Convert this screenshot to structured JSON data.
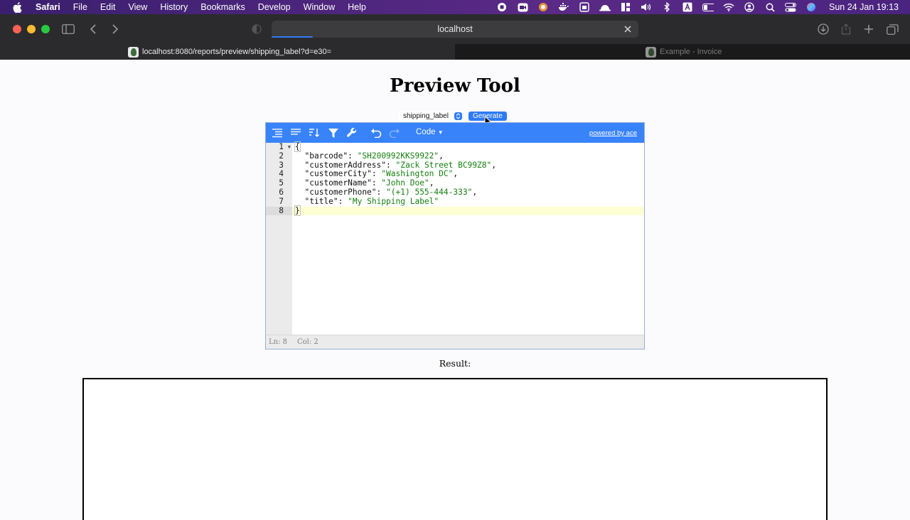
{
  "menubar": {
    "app_name": "Safari",
    "items": [
      "File",
      "Edit",
      "View",
      "History",
      "Bookmarks",
      "Develop",
      "Window",
      "Help"
    ],
    "clock": "Sun 24 Jan  19:13"
  },
  "browser": {
    "address": "localhost",
    "tabs": [
      {
        "title": "localhost:8080/reports/preview/shipping_label?d=e30="
      },
      {
        "title": "Example - Invoice"
      }
    ]
  },
  "page": {
    "title": "Preview Tool",
    "template_select": "shipping_label",
    "generate_label": "Generate",
    "result_label": "Result:"
  },
  "editor": {
    "mode_label": "Code",
    "powered_by": "powered by ace",
    "line_numbers": [
      "1",
      "2",
      "3",
      "4",
      "5",
      "6",
      "7",
      "8"
    ],
    "json_lines": [
      {
        "key": "barcode",
        "value": "SH200992KKS9922"
      },
      {
        "key": "customerAddress",
        "value": "Zack Street BC99Z8"
      },
      {
        "key": "customerCity",
        "value": "Washington DC"
      },
      {
        "key": "customerName",
        "value": "John Doe"
      },
      {
        "key": "customerPhone",
        "value": "(+1) 555-444-333"
      },
      {
        "key": "title",
        "value": "My Shipping Label"
      }
    ],
    "open_brace": "{",
    "close_brace": "}",
    "status": {
      "line": "Ln: 8",
      "col": "Col: 2"
    }
  },
  "colors": {
    "accent": "#3883fa",
    "string": "#15800f",
    "menubar": "#4a2478"
  }
}
